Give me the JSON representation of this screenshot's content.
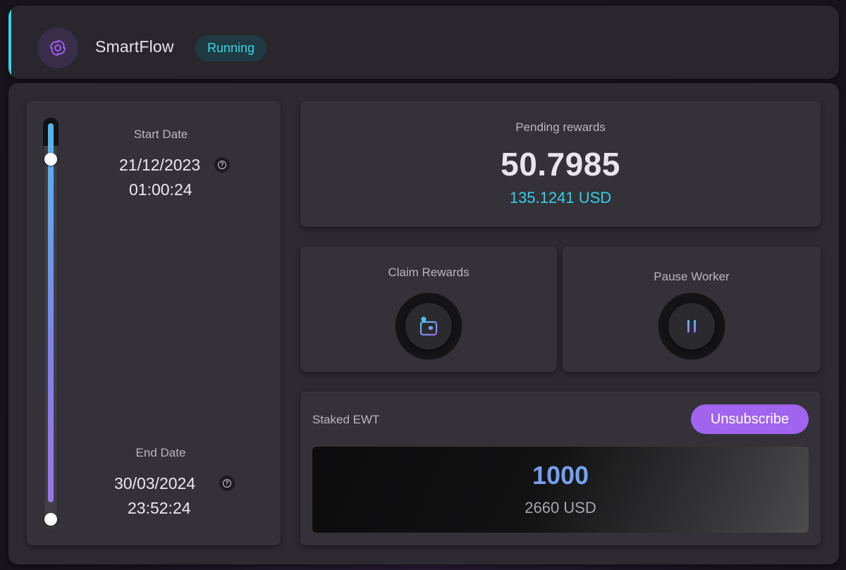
{
  "header": {
    "app_title": "SmartFlow",
    "status": "Running",
    "logo_icon": "swirl-logo-icon",
    "accent_color": "#2fd6ec"
  },
  "timeline": {
    "start": {
      "label": "Start Date",
      "date": "21/12/2023",
      "time": "01:00:24",
      "help_icon": "question-circle-icon"
    },
    "end": {
      "label": "End Date",
      "date": "30/03/2024",
      "time": "23:52:24",
      "help_icon": "question-circle-icon"
    }
  },
  "rewards": {
    "title": "Pending rewards",
    "amount": "50.7985",
    "usd": "135.1241 USD"
  },
  "actions": {
    "claim": {
      "label": "Claim Rewards",
      "icon": "wallet-icon"
    },
    "pause": {
      "label": "Pause Worker",
      "icon": "pause-icon"
    }
  },
  "staked": {
    "label": "Staked EWT",
    "unsubscribe_label": "Unsubscribe",
    "amount": "1000",
    "usd": "2660 USD"
  },
  "colors": {
    "purple": "#a064ef",
    "cyan": "#36cfe8"
  }
}
